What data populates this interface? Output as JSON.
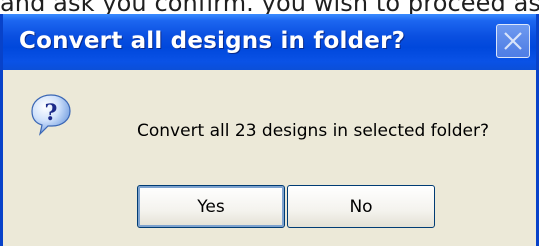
{
  "background": {
    "text": "and ask you confirm. you wish to proceed as s"
  },
  "dialog": {
    "title": "Convert all designs in folder?",
    "message": "Convert all 23 designs in selected folder?",
    "icon": "question-icon",
    "buttons": {
      "yes_label": "Yes",
      "no_label": "No"
    }
  },
  "colors": {
    "titlebar": "#0A4FE0",
    "dialog_bg": "#ECE9D8",
    "frame": "#0842C9"
  }
}
